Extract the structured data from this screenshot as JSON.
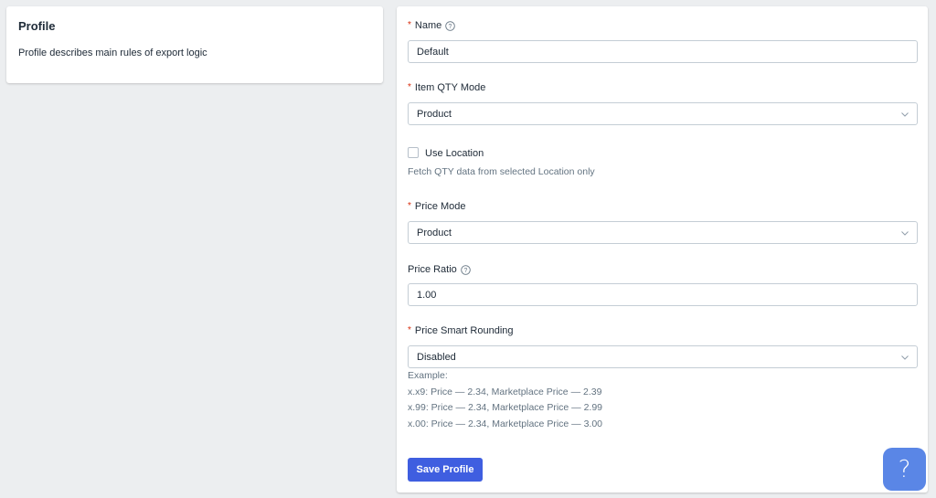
{
  "side_panel": {
    "title": "Profile",
    "description": "Profile describes main rules of export logic"
  },
  "form": {
    "name": {
      "required_mark": "*",
      "label": "Name",
      "value": "Default",
      "help_icon": "question-circle-icon"
    },
    "item_qty_mode": {
      "required_mark": "*",
      "label": "Item QTY Mode",
      "selected": "Product"
    },
    "use_location": {
      "label": "Use Location",
      "checked": false,
      "hint": "Fetch QTY data from selected Location only"
    },
    "price_mode": {
      "required_mark": "*",
      "label": "Price Mode",
      "selected": "Product"
    },
    "price_ratio": {
      "label": "Price Ratio",
      "value": "1.00",
      "help_icon": "question-circle-icon"
    },
    "price_smart_rounding": {
      "required_mark": "*",
      "label": "Price Smart Rounding",
      "selected": "Disabled",
      "example_title": "Example:",
      "examples": [
        "x.x9: Price — 2.34, Marketplace Price — 2.39",
        "x.99: Price — 2.34, Marketplace Price — 2.99",
        "x.00: Price — 2.34, Marketplace Price — 3.00"
      ]
    },
    "save_button": "Save Profile"
  },
  "help_fab": {
    "icon": "question-mark-icon",
    "glyph": "?"
  },
  "colors": {
    "background": "#eceef0",
    "primary_button": "#3f5ee0",
    "required": "#d72c0d",
    "help_fab": "#5a86e6"
  }
}
